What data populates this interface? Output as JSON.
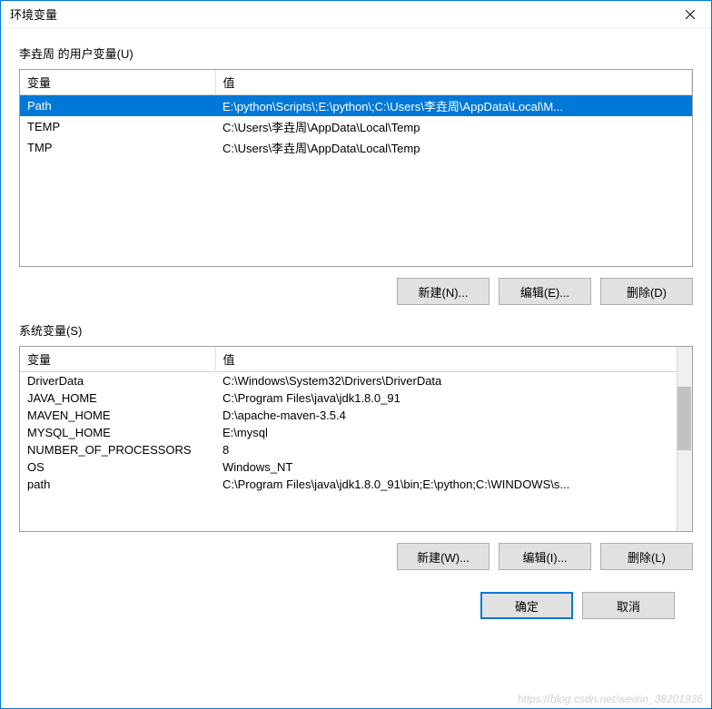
{
  "window": {
    "title": "环境变量"
  },
  "user_section": {
    "label": "李垚周 的用户变量(U)",
    "columns": {
      "var": "变量",
      "val": "值"
    },
    "rows": [
      {
        "var": "Path",
        "val": "E:\\python\\Scripts\\;E:\\python\\;C:\\Users\\李垚周\\AppData\\Local\\M...",
        "selected": true
      },
      {
        "var": "TEMP",
        "val": "C:\\Users\\李垚周\\AppData\\Local\\Temp",
        "selected": false
      },
      {
        "var": "TMP",
        "val": "C:\\Users\\李垚周\\AppData\\Local\\Temp",
        "selected": false
      }
    ],
    "buttons": {
      "new": "新建(N)...",
      "edit": "编辑(E)...",
      "delete": "删除(D)"
    }
  },
  "system_section": {
    "label": "系统变量(S)",
    "columns": {
      "var": "变量",
      "val": "值"
    },
    "rows": [
      {
        "var": "DriverData",
        "val": "C:\\Windows\\System32\\Drivers\\DriverData"
      },
      {
        "var": "JAVA_HOME",
        "val": "C:\\Program Files\\java\\jdk1.8.0_91"
      },
      {
        "var": "MAVEN_HOME",
        "val": "D:\\apache-maven-3.5.4"
      },
      {
        "var": "MYSQL_HOME",
        "val": "E:\\mysql"
      },
      {
        "var": "NUMBER_OF_PROCESSORS",
        "val": "8"
      },
      {
        "var": "OS",
        "val": "Windows_NT"
      },
      {
        "var": "path",
        "val": "C:\\Program Files\\java\\jdk1.8.0_91\\bin;E:\\python;C:\\WINDOWS\\s..."
      }
    ],
    "buttons": {
      "new": "新建(W)...",
      "edit": "编辑(I)...",
      "delete": "删除(L)"
    }
  },
  "footer": {
    "ok": "确定",
    "cancel": "取消"
  },
  "watermark": "https://blog.csdn.net/weixin_38201936"
}
